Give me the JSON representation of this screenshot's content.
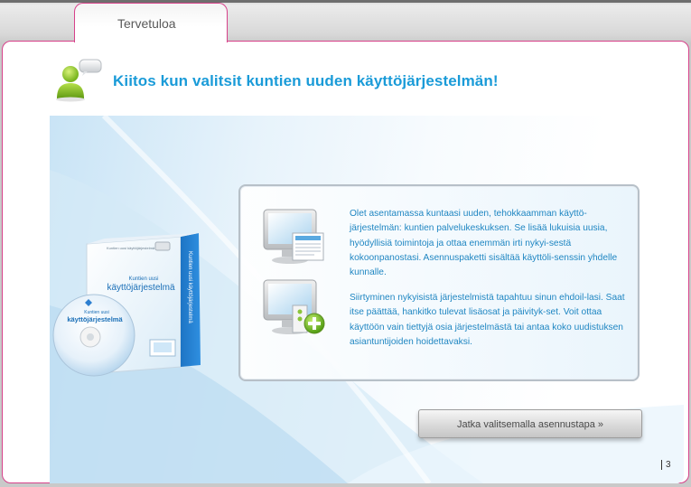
{
  "tab": {
    "label": "Tervetuloa"
  },
  "header": {
    "title": "Kiitos kun valitsit kuntien uuden käyttöjärjestelmän!"
  },
  "product": {
    "box_small_text": "Kuntien uusi käyttöjärjestelmä",
    "box_title_line1": "Kuntien uusi",
    "box_title_line2": "käyttöjärjestelmä",
    "box_spine": "Kuntien uusi käyttöjärjestelmä",
    "cd_title_line1": "Kuntien uusi",
    "cd_title_line2": "käyttöjärjestelmä"
  },
  "info": {
    "paragraph1": "Olet asentamassa kuntaasi uuden, tehokkaamman käyttö-järjestelmän: kuntien palvelukeskuksen. Se lisää lukuisia uusia, hyödyllisiä toimintoja ja ottaa enemmän irti nykyi-sestä kokoonpanostasi. Asennuspaketti sisältää käyttöli-senssin yhdelle kunnalle.",
    "paragraph2": "Siirtyminen nykyisistä järjestelmistä tapahtuu sinun ehdoil-lasi. Saat itse päättää, hankitko tulevat lisäosat ja päivityk-set. Voit ottaa käyttöön vain tiettyjä osia järjestelmästä tai antaa koko uudistuksen asiantuntijoiden hoidettavaksi."
  },
  "actions": {
    "continue_label": "Jatka valitsemalla asennustapa »"
  },
  "footer": {
    "page_number": "3"
  },
  "colors": {
    "accent": "#d7418a",
    "title": "#1a9bd8",
    "body_text": "#1f86c2"
  },
  "icons": {
    "header": "user-chat-icon",
    "monitor1": "monitor-document-icon",
    "monitor2": "monitor-add-icon"
  }
}
